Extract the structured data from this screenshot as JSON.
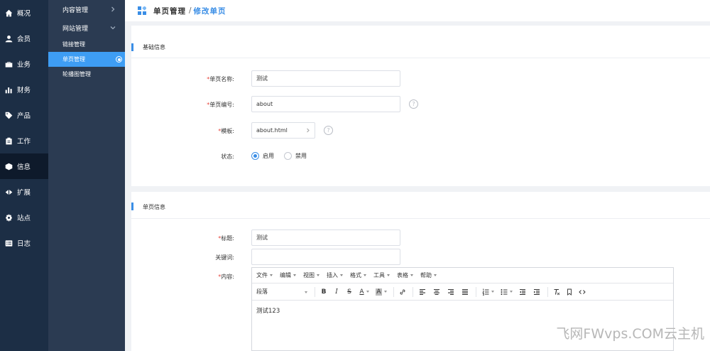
{
  "nav1": {
    "items": [
      {
        "label": "概况",
        "icon": "home-icon"
      },
      {
        "label": "会员",
        "icon": "user-icon"
      },
      {
        "label": "业务",
        "icon": "briefcase-icon"
      },
      {
        "label": "财务",
        "icon": "bar-chart-icon"
      },
      {
        "label": "产品",
        "icon": "tag-icon"
      },
      {
        "label": "工作",
        "icon": "clipboard-icon"
      },
      {
        "label": "信息",
        "icon": "cube-icon"
      },
      {
        "label": "扩展",
        "icon": "code-icon"
      },
      {
        "label": "站点",
        "icon": "gear-icon"
      },
      {
        "label": "日志",
        "icon": "list-icon"
      }
    ],
    "active": "信息"
  },
  "nav2": {
    "groups": [
      {
        "label": "内容管理",
        "expanded": false
      },
      {
        "label": "网站管理",
        "expanded": true
      }
    ],
    "subitems": [
      {
        "label": "链接管理",
        "active": false
      },
      {
        "label": "单页管理",
        "active": true
      },
      {
        "label": "轮播图管理",
        "active": false
      }
    ]
  },
  "header": {
    "crumb1": "单页管理",
    "separator": "/",
    "crumb2": "修改单页"
  },
  "basic": {
    "title": "基础信息",
    "name_label": "单页名称:",
    "name_value": "测试",
    "code_label": "单页编号:",
    "code_value": "about",
    "template_label": "模板:",
    "template_value": "about.html",
    "status_label": "状态:",
    "status_on": "启用",
    "status_off": "禁用",
    "status_selected": "启用",
    "help_glyph": "?",
    "required_mark": "*"
  },
  "page": {
    "title": "单页信息",
    "title_label": "标题:",
    "title_value": "测试",
    "keywords_label": "关键词:",
    "keywords_value": "",
    "content_label": "内容:"
  },
  "editor": {
    "menu": [
      "文件",
      "编辑",
      "视图",
      "插入",
      "格式",
      "工具",
      "表格",
      "帮助"
    ],
    "format_value": "段落",
    "bold": "B",
    "italic": "I",
    "strike": "S",
    "font_color": "A",
    "bg_color": "A",
    "content": "测试123"
  },
  "watermark": "飞网FWvps.COM云主机",
  "colors": {
    "accent": "#3a8ee6",
    "sidebar_dark": "#1c2e45",
    "sidebar_mid": "#2b3b52",
    "active_sub": "#3e9df4",
    "required": "#e6453c"
  }
}
